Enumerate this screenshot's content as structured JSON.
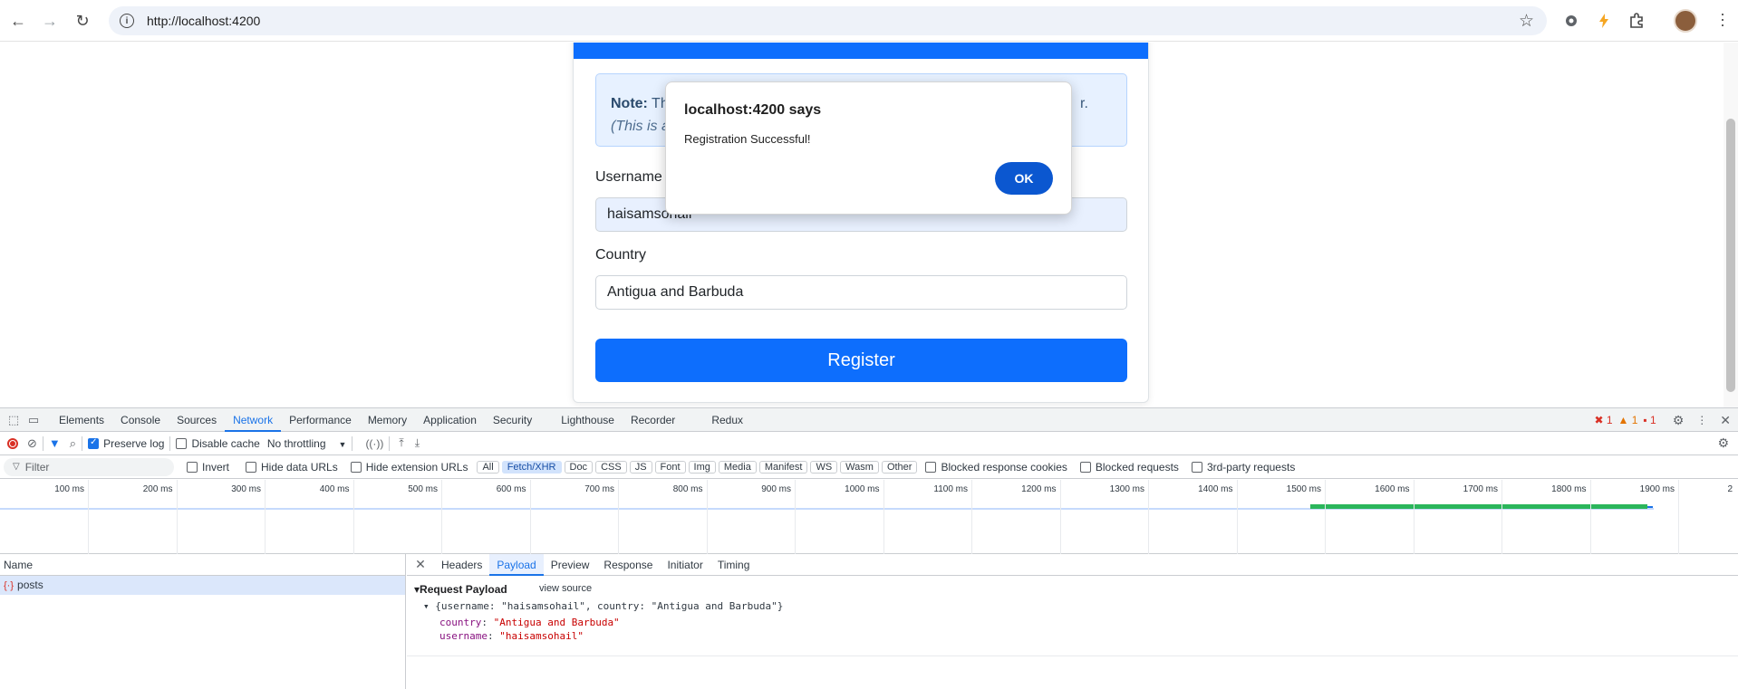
{
  "browser": {
    "url": "http://localhost:4200",
    "icons": [
      "back-icon",
      "forward-icon",
      "reload-icon",
      "info-icon",
      "star-icon",
      "extensions-icon",
      "avatar",
      "menu-icon"
    ]
  },
  "page": {
    "note_prefix": "Note:",
    "note_visible_1": " Th",
    "note_visible_end": "r.",
    "note_visible_2": "(This is a",
    "username_label": "Username",
    "username_value": "haisamsohail",
    "country_label": "Country",
    "country_value": "Antigua and Barbuda",
    "register_label": "Register",
    "colors": {
      "primary": "#0d6efd",
      "note_bg": "#e7f1ff"
    }
  },
  "dialog": {
    "title": "localhost:4200 says",
    "message": "Registration Successful!",
    "ok_label": "OK"
  },
  "devtools": {
    "tabs": [
      "Elements",
      "Console",
      "Sources",
      "Network",
      "Performance",
      "Memory",
      "Application",
      "Security",
      "Lighthouse",
      "Recorder",
      "Redux"
    ],
    "active_tab": "Network",
    "errors": "1",
    "warnings": "1",
    "issues": "1",
    "preserve_log": "Preserve log",
    "disable_cache": "Disable cache",
    "throttling": "No throttling",
    "filter_placeholder": "Filter",
    "invert": "Invert",
    "hide_data_urls": "Hide data URLs",
    "hide_ext_urls": "Hide extension URLs",
    "types": [
      "All",
      "Fetch/XHR",
      "Doc",
      "CSS",
      "JS",
      "Font",
      "Img",
      "Media",
      "Manifest",
      "WS",
      "Wasm",
      "Other"
    ],
    "active_type": "Fetch/XHR",
    "blocked_cookies": "Blocked response cookies",
    "blocked_requests": "Blocked requests",
    "third_party": "3rd-party requests",
    "timeline_ticks": [
      "100 ms",
      "200 ms",
      "300 ms",
      "400 ms",
      "500 ms",
      "600 ms",
      "700 ms",
      "800 ms",
      "900 ms",
      "1000 ms",
      "1100 ms",
      "1200 ms",
      "1300 ms",
      "1400 ms",
      "1500 ms",
      "1600 ms",
      "1700 ms",
      "1800 ms",
      "1900 ms",
      "2"
    ],
    "name_header": "Name",
    "request_name": "posts",
    "detail_tabs": [
      "Headers",
      "Payload",
      "Preview",
      "Response",
      "Initiator",
      "Timing"
    ],
    "active_detail_tab": "Payload",
    "request_payload_label": "Request Payload",
    "view_source": "view source",
    "payload_summary": "{username: \"haisamsohail\", country: \"Antigua and Barbuda\"}",
    "payload_props": [
      {
        "key": "country",
        "value": "\"Antigua and Barbuda\""
      },
      {
        "key": "username",
        "value": "\"haisamsohail\""
      }
    ]
  }
}
